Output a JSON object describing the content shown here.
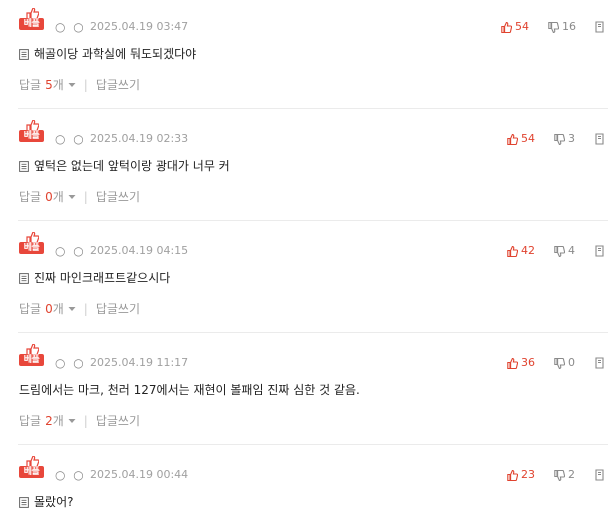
{
  "best_badge": "베플",
  "author_mark": "○ ○",
  "reply_label": "답글",
  "reply_unit": "개",
  "write_reply": "답글쓰기",
  "separator": "|",
  "colors": {
    "accent": "#e8473b",
    "up": "#e0432f",
    "muted": "#999999"
  },
  "comments": [
    {
      "date": "2025.04.19 03:47",
      "up": "54",
      "down": "16",
      "text": "해골이당 과학실에 둬도되겠다야",
      "has_icon": true,
      "reply_count": "5"
    },
    {
      "date": "2025.04.19 02:33",
      "up": "54",
      "down": "3",
      "text": "옆턱은 없는데 앞턱이랑 광대가 너무 커",
      "has_icon": true,
      "reply_count": "0"
    },
    {
      "date": "2025.04.19 04:15",
      "up": "42",
      "down": "4",
      "text": "진짜 마인크래프트같으시다",
      "has_icon": true,
      "reply_count": "0"
    },
    {
      "date": "2025.04.19 11:17",
      "up": "36",
      "down": "0",
      "text": "드림에서는 마크, 천러 127에서는 재현이 볼패임 진짜 심한 것 같음.",
      "has_icon": false,
      "reply_count": "2"
    },
    {
      "date": "2025.04.19 00:44",
      "up": "23",
      "down": "2",
      "text": "몰랐어?",
      "has_icon": true,
      "reply_count": null
    }
  ]
}
